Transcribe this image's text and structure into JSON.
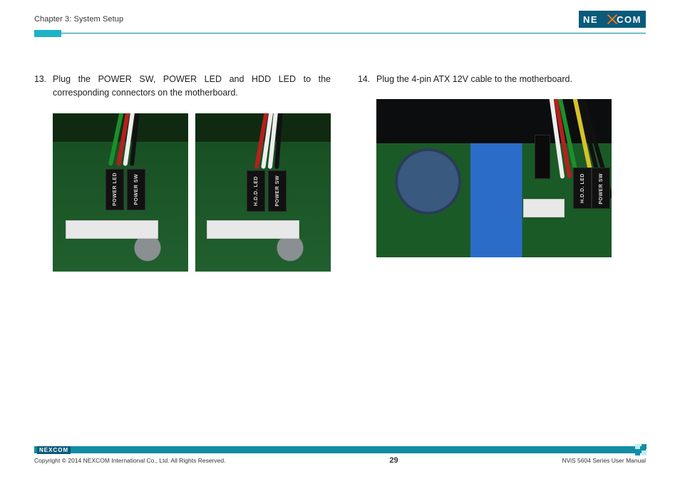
{
  "header": {
    "chapter": "Chapter 3: System Setup",
    "brand": "NEXCOM"
  },
  "steps": {
    "left": {
      "number": "13.",
      "text": "Plug the POWER SW, POWER LED and HDD LED to the corresponding connectors on the motherboard."
    },
    "right": {
      "number": "14.",
      "text": "Plug the 4-pin ATX 12V cable to the motherboard."
    }
  },
  "photo_labels": {
    "power_led": "POWER LED",
    "power_sw": "POWER SW",
    "hdd_led": "H.D.D. LED"
  },
  "footer": {
    "copyright": "Copyright © 2014 NEXCOM International Co., Ltd. All Rights Reserved.",
    "page": "29",
    "doc": "NViS 5604 Series User Manual"
  }
}
